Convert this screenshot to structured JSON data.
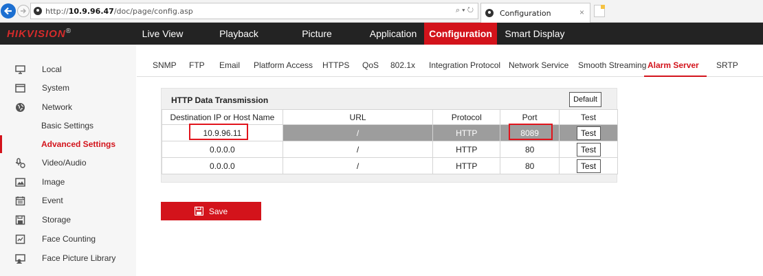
{
  "browser": {
    "url_prefix": "http://",
    "url_host": "10.9.96.47",
    "url_path": "/doc/page/config.asp",
    "address_tools": "⌕ ▾ ↻",
    "tab_title": "Configuration",
    "tab_close": "×"
  },
  "nav": {
    "logo": "HIKVISION",
    "logo_mark": "®",
    "items": [
      "Live View",
      "Playback",
      "Picture",
      "Application",
      "Configuration",
      "Smart Display"
    ],
    "active": "Configuration"
  },
  "sidebar": {
    "items": [
      {
        "label": "Local",
        "icon": "monitor-icon"
      },
      {
        "label": "System",
        "icon": "system-window-icon"
      },
      {
        "label": "Network",
        "icon": "globe-icon"
      },
      {
        "label": "Basic Settings"
      },
      {
        "label": "Advanced Settings",
        "active": true
      },
      {
        "label": "Video/Audio",
        "icon": "mic-camera-icon"
      },
      {
        "label": "Image",
        "icon": "image-icon"
      },
      {
        "label": "Event",
        "icon": "calendar-icon"
      },
      {
        "label": "Storage",
        "icon": "storage-icon"
      },
      {
        "label": "Face Counting",
        "icon": "face-counting-icon"
      },
      {
        "label": "Face Picture Library",
        "icon": "face-library-icon"
      }
    ],
    "accent_color": "#d3131b"
  },
  "subtabs": {
    "items": [
      "SNMP",
      "FTP",
      "Email",
      "Platform Access",
      "HTTPS",
      "QoS",
      "802.1x",
      "Integration Protocol",
      "Network Service",
      "Smooth Streaming",
      "Alarm Server",
      "SRTP"
    ],
    "active": "Alarm Server"
  },
  "panel": {
    "title": "HTTP Data Transmission",
    "default_label": "Default",
    "columns": [
      "Destination IP or Host Name",
      "URL",
      "Protocol",
      "Port",
      "Test"
    ],
    "rows": [
      {
        "host": "10.9.96.11",
        "url": "/",
        "protocol": "HTTP",
        "port": "8089",
        "test": "Test",
        "selected": true
      },
      {
        "host": "0.0.0.0",
        "url": "/",
        "protocol": "HTTP",
        "port": "80",
        "test": "Test"
      },
      {
        "host": "0.0.0.0",
        "url": "/",
        "protocol": "HTTP",
        "port": "80",
        "test": "Test"
      }
    ]
  },
  "save_label": "Save",
  "colors": {
    "brand_red": "#d3131b",
    "nav_bg": "#232323",
    "selected_row": "#9d9d9d",
    "highlight_box": "#e1131b"
  }
}
